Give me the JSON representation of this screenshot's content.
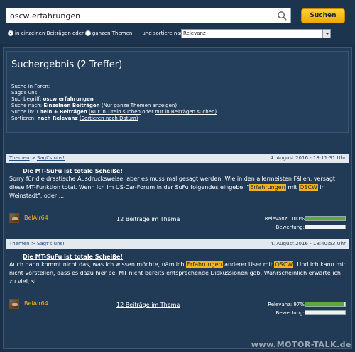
{
  "search": {
    "query": "oscw erfahrungen",
    "button_label": "Suchen",
    "opt_single": "in einzelnen Beiträgen oder",
    "opt_threads": "ganzen Themen",
    "sort_label": "und sortiere nach:",
    "sort_value": "Relevanz"
  },
  "results": {
    "title": "Suchergebnis (2 Treffer)",
    "meta": {
      "line1": "Suche in Foren:",
      "line2": "Sagt's uns!",
      "term_label": "Suchbegriff:",
      "term_value": "oscw erfahrungen",
      "after_label": "Suche nach:",
      "after_value": "Einzelnen Beiträgen",
      "after_link": "(Nur ganze Themen anzeigen)",
      "in_label": "Suche in:",
      "in_value": "Titeln + Beiträgen",
      "in_link1": "(Nur in Titeln suchen",
      "in_or": "oder",
      "in_link2": "nur in Beiträgen suchen)",
      "sort_label": "Sortieren:",
      "sort_value": "nach Relevanz",
      "sort_link": "(Sortieren nach Datum)"
    }
  },
  "entries": [
    {
      "crumb1": "Themen",
      "crumb_sep": ">",
      "crumb2": "Sagt's uns!",
      "date": "4. August 2016 - 18:11:31 Uhr",
      "title": "Die MT-SuFu ist totale Scheiße!",
      "text_a": "Sorry für die drastische Ausdrucksweise, aber es muss mal gesagt werden. Wie in den allermeisten Fällen, versagt diese MT-Funktion total. Wenn ich im US-Car-Forum in der SuFu folgendes eingebe: \"",
      "hl1": "Erfahrungen",
      "text_b": " mit ",
      "hl2": "OSCW",
      "text_c": " in Weinstadt\", oder ...",
      "user": "BelAir64",
      "thread_link": "12 Beiträge im Thema",
      "relevance_label": "Relevanz: 100%",
      "relevance": 1.0,
      "rating_label": "Bewertung:"
    },
    {
      "crumb1": "Themen",
      "crumb_sep": ">",
      "crumb2": "Sagt's uns!",
      "date": "4. August 2016 - 18:40:53 Uhr",
      "title": "Die MT-SuFu ist totale Scheiße!",
      "text_a": "Auch dann kommt nicht das, was ich wissen möchte, nämlich ",
      "hl1": "Erfahrungen",
      "text_b": " anderer User mit ",
      "hl2": "OSCW",
      "text_c": ". Und ich kann mir nicht vorstellen, dass es dazu hier bei MT nicht bereits entsprechende Diskussionen gab. Wahrscheinlich erwarte ich zu viel, si...",
      "user": "BelAir64",
      "thread_link": "12 Beiträge im Thema",
      "relevance_label": "Relevanz: 97%",
      "relevance": 0.97,
      "rating_label": "Bewertung:"
    }
  ],
  "watermark": "www.MOTOR-TALK.de",
  "colors": {
    "accent": "#f2b21b",
    "bg": "#1a3048",
    "panel": "#213a55",
    "bar_fill": "#5aaa3a"
  }
}
